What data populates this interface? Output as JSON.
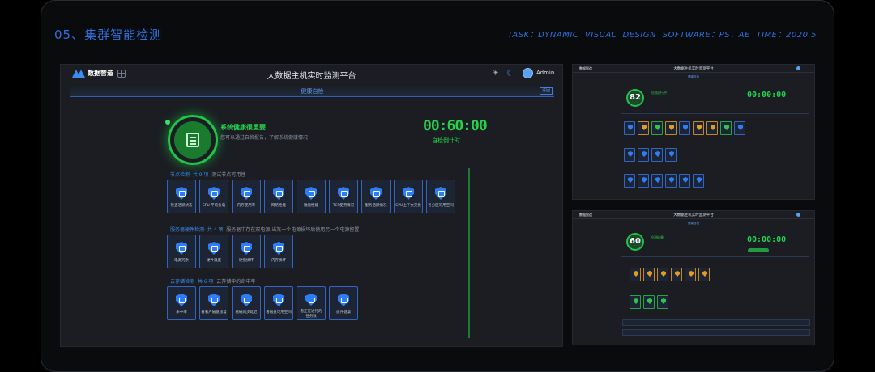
{
  "header": {
    "title": "05、集群智能检测",
    "meta": "TASK：DYNAMIC VISUAL DESIGN   SOFTWARE：PS、AE   TIME：2020.5"
  },
  "app": {
    "brand": "数据智造",
    "title": "大数据主机实时监测平台",
    "user": "Admin",
    "subtitle": "健康自检",
    "return_label": "返回"
  },
  "health": {
    "title": "系统健康很重要",
    "desc": "您可以通过自检报告，了解系统健康情况",
    "timer": "00:60:00",
    "timer_label": "自检倒计时"
  },
  "sections": [
    {
      "title": "节点检测",
      "count": "· 共 9 项",
      "desc": "测试节点可用性",
      "items": [
        "检查活跃状态",
        "CPU 平均负载",
        "内存使用率",
        "网络性能",
        "磁盘性能",
        "TCP使用情况",
        "服务活跃情况",
        "CPU上下文交换",
        "各分区可用空间"
      ]
    },
    {
      "title": "服务器硬件检测",
      "count": "· 共 4 项",
      "desc": "服务器中存在双电源,当某一个电源损坏后使用另一个电源留置",
      "items": [
        "电源冗余",
        "硬件温度",
        "硬盘损坏",
        "内存损坏"
      ]
    },
    {
      "title": "云存储检测",
      "count": "· 共 6 项",
      "desc": "云存储中的命中率",
      "items": [
        "命中率",
        "看看户磁盘接着",
        "看磁同步延迟",
        "看磁盘可用空间",
        "看正在进行的\n任务数",
        "组件健康"
      ]
    }
  ],
  "thumbs": [
    {
      "score": "82",
      "timer": "00:00:00",
      "status": "检测进行中"
    },
    {
      "score": "60",
      "timer": "00:00:00",
      "status": "检测结果"
    }
  ],
  "colors": {
    "accent": "#2f7df5",
    "success": "#23d34c",
    "warning": "#e39c22",
    "bg": "#1b1d23"
  }
}
